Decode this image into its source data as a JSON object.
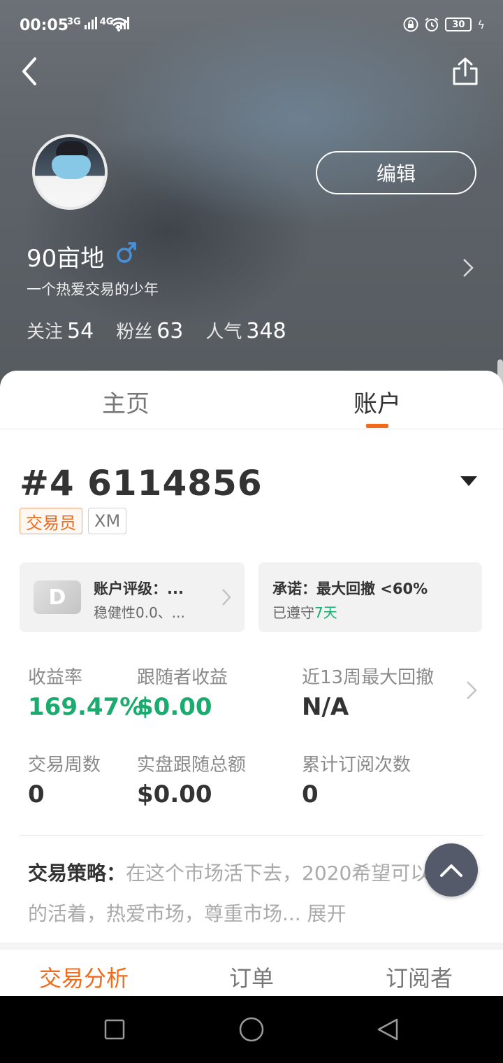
{
  "status": {
    "time": "00:05",
    "net1": "3G",
    "net2": "4G",
    "battery": "30"
  },
  "profile": {
    "name": "90亩地",
    "gender_icon": "male-icon",
    "bio": "一个热爱交易的少年",
    "edit_label": "编辑",
    "stats": [
      {
        "label": "关注",
        "value": "54"
      },
      {
        "label": "粉丝",
        "value": "63"
      },
      {
        "label": "人气",
        "value": "348"
      }
    ]
  },
  "tabs": {
    "home": "主页",
    "account": "账户"
  },
  "account": {
    "number": "#4 6114856",
    "badges": {
      "role": "交易员",
      "broker": "XM"
    },
    "rating": {
      "grade": "D",
      "title": "账户评级：...",
      "subtitle": "稳健性0.0、..."
    },
    "promise": {
      "title": "承诺：最大回撤 <60%",
      "prefix": "已遵守",
      "days": "7天"
    },
    "metrics": {
      "return_rate": {
        "label": "收益率",
        "value": "169.47%"
      },
      "follower_profit": {
        "label": "跟随者收益",
        "value": "$0.00"
      },
      "max_drawdown": {
        "label": "近13周最大回撤",
        "value": "N/A"
      },
      "trade_weeks": {
        "label": "交易周数",
        "value": "0"
      },
      "follow_total": {
        "label": "实盘跟随总额",
        "value": "$0.00"
      },
      "sub_count": {
        "label": "累计订阅次数",
        "value": "0"
      }
    },
    "strategy": {
      "label": "交易策略：",
      "text": "在这个市场活下去，2020希望可以好好的活着，热爱市场，尊重市场...",
      "expand": "展开"
    }
  },
  "bottom_tabs": {
    "analysis": "交易分析",
    "orders": "订单",
    "subscribers": "订阅者"
  },
  "colors": {
    "accent": "#f26b1d",
    "green": "#1aab6f"
  }
}
